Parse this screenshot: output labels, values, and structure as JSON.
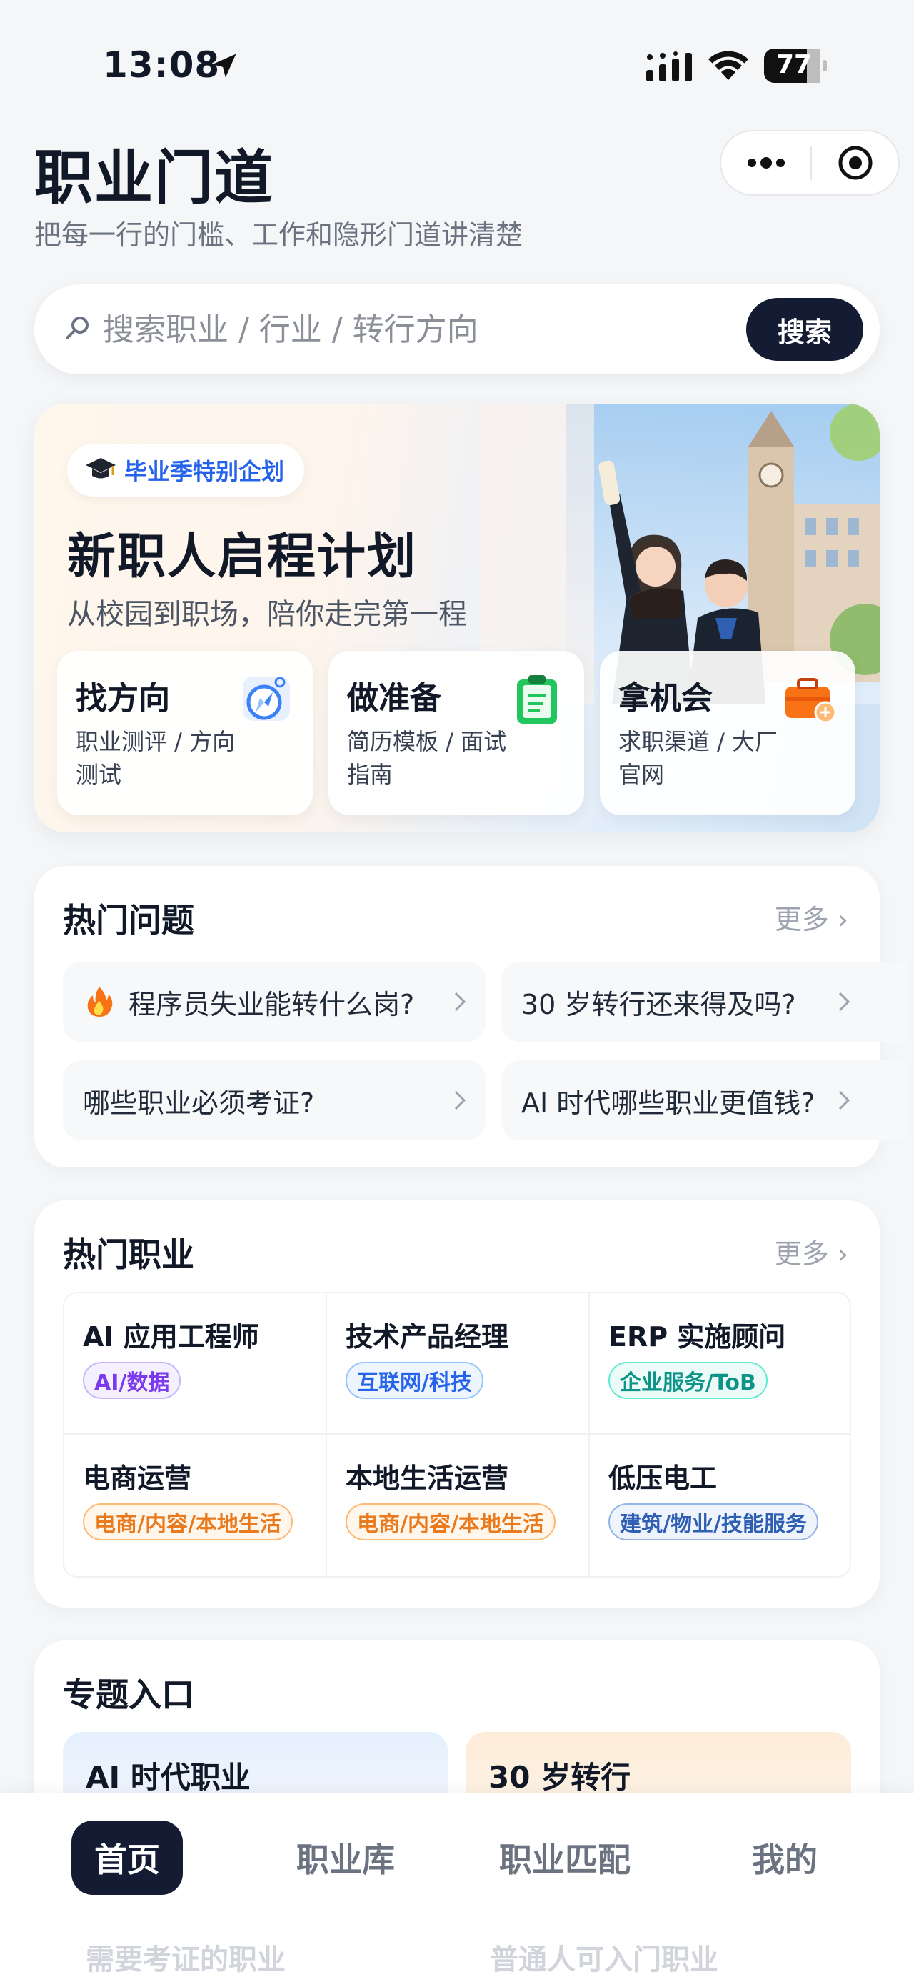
{
  "status_bar": {
    "time": "13:08",
    "battery": "77"
  },
  "header": {
    "title": "职业门道",
    "subtitle": "把每一行的门槛、工作和隐形门道讲清楚"
  },
  "search": {
    "placeholder": "搜索职业 / 行业 / 转行方向",
    "button_label": "搜索"
  },
  "banner": {
    "badge": "毕业季特别企划",
    "title": "新职人启程计划",
    "subtitle": "从校园到职场，陪你走完第一程",
    "cards": [
      {
        "title": "找方向",
        "desc": "职业测评 / 方向测试",
        "icon": "compass-icon"
      },
      {
        "title": "做准备",
        "desc": "简历模板 / 面试指南",
        "icon": "clipboard-icon"
      },
      {
        "title": "拿机会",
        "desc": "求职渠道 / 大厂官网",
        "icon": "briefcase-icon"
      }
    ]
  },
  "hot_questions": {
    "title": "热门问题",
    "more": "更多 ›",
    "items": [
      "程序员失业能转什么岗?",
      "30 岁转行还来得及吗?",
      "哪些职业必须考证?",
      "AI 时代哪些职业更值钱?"
    ]
  },
  "hot_careers": {
    "title": "热门职业",
    "more": "更多 ›",
    "items": [
      {
        "name": "AI 应用工程师",
        "tag": "AI/数据",
        "color": "#7c3aed",
        "bg": "#f5f0ff"
      },
      {
        "name": "技术产品经理",
        "tag": "互联网/科技",
        "color": "#2563eb",
        "bg": "#eff5ff"
      },
      {
        "name": "ERP 实施顾问",
        "tag": "企业服务/ToB",
        "color": "#0d9488",
        "bg": "#ecfbf7"
      },
      {
        "name": "电商运营",
        "tag": "电商/内容/本地生活",
        "color": "#ea7a1e",
        "bg": "#fff6ec"
      },
      {
        "name": "本地生活运营",
        "tag": "电商/内容/本地生活",
        "color": "#ea7a1e",
        "bg": "#fff6ec"
      },
      {
        "name": "低压电工",
        "tag": "建筑/物业/技能服务",
        "color": "#2f5fb3",
        "bg": "#eef3fc"
      }
    ]
  },
  "topics": {
    "title": "专题入口",
    "items": [
      {
        "title": "AI 时代职业",
        "bg": "#e9f2fd"
      },
      {
        "title": "30 岁转行",
        "bg": "#fdf1e3"
      }
    ],
    "hidden_items": [
      "需要考证的职业",
      "普通人可入门职业"
    ]
  },
  "bottom_nav": {
    "items": [
      "首页",
      "职业库",
      "职业匹配",
      "我的"
    ],
    "active": 0
  },
  "colors": {
    "primary_dark": "#141c33",
    "accent_blue": "#2563eb",
    "background": "#f5f6f8"
  }
}
